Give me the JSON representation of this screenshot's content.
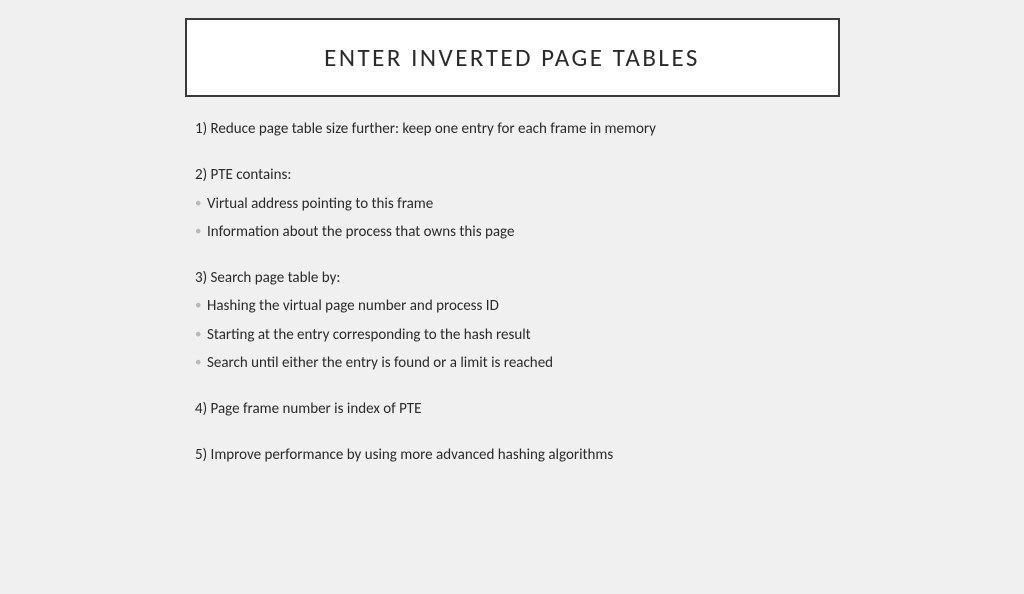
{
  "title": "ENTER INVERTED PAGE TABLES",
  "items": [
    {
      "heading": "1) Reduce page table size further: keep one entry for each frame in memory",
      "subs": []
    },
    {
      "heading": "2) PTE contains:",
      "subs": [
        "Virtual address pointing to this frame",
        "Information about the process that owns this page"
      ]
    },
    {
      "heading": "3) Search page table by:",
      "subs": [
        "Hashing the virtual page number and process ID",
        "Starting at the entry corresponding to the hash result",
        "Search until either the entry is found or a limit is reached"
      ]
    },
    {
      "heading": "4) Page frame number is index of PTE",
      "subs": []
    },
    {
      "heading": "5) Improve performance by using more advanced hashing algorithms",
      "subs": []
    }
  ]
}
